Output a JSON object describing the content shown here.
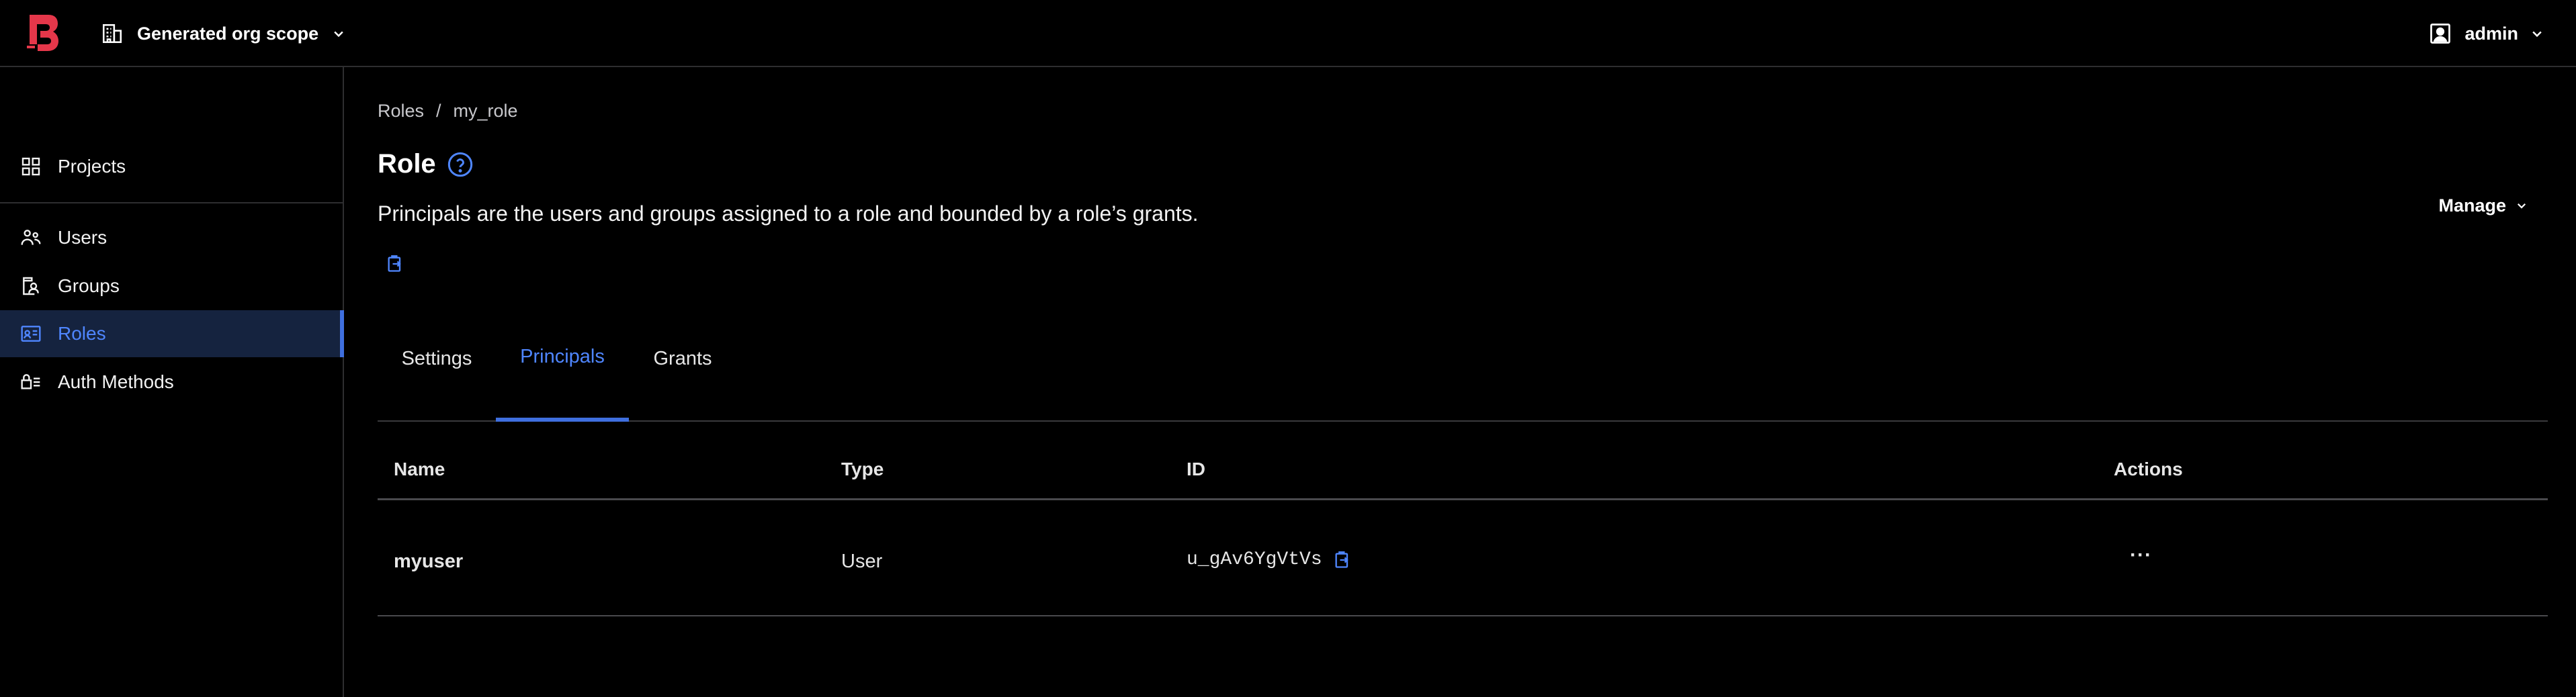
{
  "topbar": {
    "scope_label": "Generated org scope",
    "user_label": "admin"
  },
  "sidebar": {
    "items": [
      {
        "label": "Projects",
        "icon": "grid-icon"
      },
      {
        "label": "Users",
        "icon": "users-icon"
      },
      {
        "label": "Groups",
        "icon": "groups-icon"
      },
      {
        "label": "Roles",
        "icon": "roles-icon",
        "active": true
      },
      {
        "label": "Auth Methods",
        "icon": "auth-methods-icon"
      }
    ]
  },
  "main": {
    "breadcrumb": {
      "parent": "Roles",
      "separator": "/",
      "current": "my_role"
    },
    "title": "Role",
    "description": "Principals are the users and groups assigned to a role and bounded by a role’s grants.",
    "manage_label": "Manage",
    "tabs": [
      {
        "label": "Settings"
      },
      {
        "label": "Principals",
        "active": true
      },
      {
        "label": "Grants"
      }
    ],
    "table": {
      "headers": [
        "Name",
        "Type",
        "ID",
        "Actions"
      ],
      "rows": [
        {
          "name": "myuser",
          "type": "User",
          "id": "u_gAv6YgVtVs",
          "actions": "···"
        }
      ]
    }
  },
  "colors": {
    "accent": "#4f86ff",
    "logo": "#e5374a",
    "active_bg": "#15233f"
  }
}
